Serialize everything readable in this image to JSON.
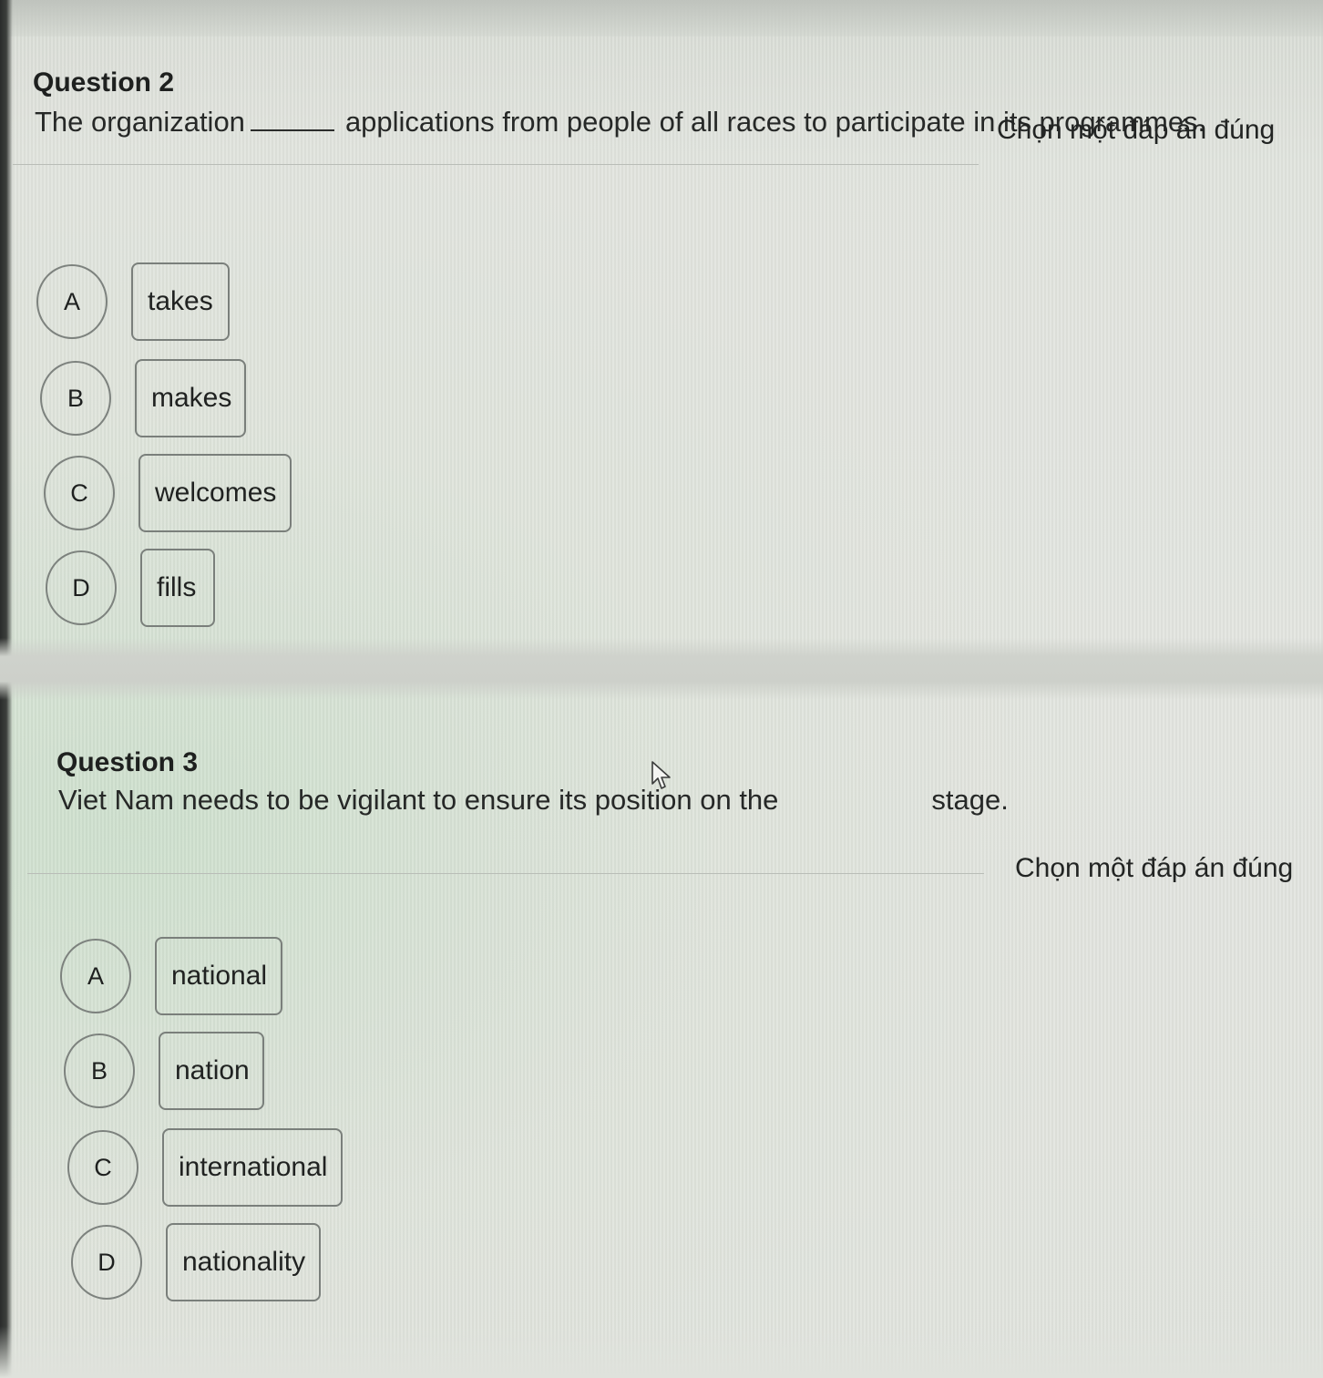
{
  "questions": [
    {
      "title": "Question 2",
      "text_before": "The organization",
      "text_after": "applications from people of all races to participate in its programmes.",
      "instruction": "Chọn một đáp án đúng",
      "options": [
        {
          "letter": "A",
          "label": "takes"
        },
        {
          "letter": "B",
          "label": "makes"
        },
        {
          "letter": "C",
          "label": "welcomes"
        },
        {
          "letter": "D",
          "label": "fills"
        }
      ]
    },
    {
      "title": "Question 3",
      "text_before": "Viet Nam needs to be vigilant to ensure its position on the",
      "text_after": "stage.",
      "instruction": "Chọn một đáp án đúng",
      "options": [
        {
          "letter": "A",
          "label": "national"
        },
        {
          "letter": "B",
          "label": "nation"
        },
        {
          "letter": "C",
          "label": "international"
        },
        {
          "letter": "D",
          "label": "nationality"
        }
      ]
    }
  ],
  "icons": {
    "cursor": "mouse-pointer-arrow"
  }
}
